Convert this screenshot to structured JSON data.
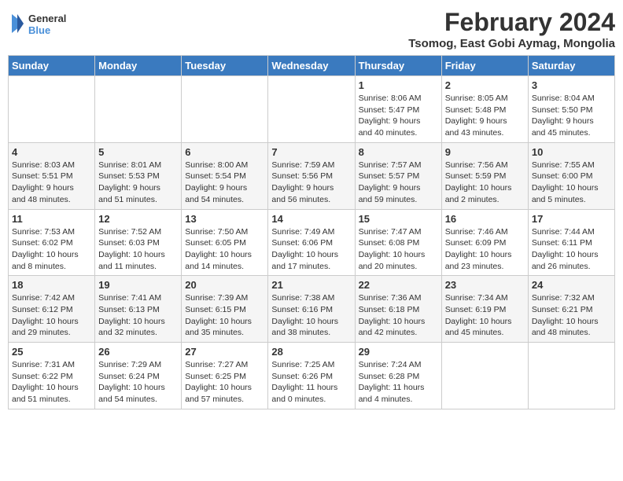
{
  "logo": {
    "line1": "General",
    "line2": "Blue"
  },
  "title": "February 2024",
  "location": "Tsomog, East Gobi Aymag, Mongolia",
  "days_of_week": [
    "Sunday",
    "Monday",
    "Tuesday",
    "Wednesday",
    "Thursday",
    "Friday",
    "Saturday"
  ],
  "weeks": [
    [
      {
        "day": "",
        "info": ""
      },
      {
        "day": "",
        "info": ""
      },
      {
        "day": "",
        "info": ""
      },
      {
        "day": "",
        "info": ""
      },
      {
        "day": "1",
        "info": "Sunrise: 8:06 AM\nSunset: 5:47 PM\nDaylight: 9 hours\nand 40 minutes."
      },
      {
        "day": "2",
        "info": "Sunrise: 8:05 AM\nSunset: 5:48 PM\nDaylight: 9 hours\nand 43 minutes."
      },
      {
        "day": "3",
        "info": "Sunrise: 8:04 AM\nSunset: 5:50 PM\nDaylight: 9 hours\nand 45 minutes."
      }
    ],
    [
      {
        "day": "4",
        "info": "Sunrise: 8:03 AM\nSunset: 5:51 PM\nDaylight: 9 hours\nand 48 minutes."
      },
      {
        "day": "5",
        "info": "Sunrise: 8:01 AM\nSunset: 5:53 PM\nDaylight: 9 hours\nand 51 minutes."
      },
      {
        "day": "6",
        "info": "Sunrise: 8:00 AM\nSunset: 5:54 PM\nDaylight: 9 hours\nand 54 minutes."
      },
      {
        "day": "7",
        "info": "Sunrise: 7:59 AM\nSunset: 5:56 PM\nDaylight: 9 hours\nand 56 minutes."
      },
      {
        "day": "8",
        "info": "Sunrise: 7:57 AM\nSunset: 5:57 PM\nDaylight: 9 hours\nand 59 minutes."
      },
      {
        "day": "9",
        "info": "Sunrise: 7:56 AM\nSunset: 5:59 PM\nDaylight: 10 hours\nand 2 minutes."
      },
      {
        "day": "10",
        "info": "Sunrise: 7:55 AM\nSunset: 6:00 PM\nDaylight: 10 hours\nand 5 minutes."
      }
    ],
    [
      {
        "day": "11",
        "info": "Sunrise: 7:53 AM\nSunset: 6:02 PM\nDaylight: 10 hours\nand 8 minutes."
      },
      {
        "day": "12",
        "info": "Sunrise: 7:52 AM\nSunset: 6:03 PM\nDaylight: 10 hours\nand 11 minutes."
      },
      {
        "day": "13",
        "info": "Sunrise: 7:50 AM\nSunset: 6:05 PM\nDaylight: 10 hours\nand 14 minutes."
      },
      {
        "day": "14",
        "info": "Sunrise: 7:49 AM\nSunset: 6:06 PM\nDaylight: 10 hours\nand 17 minutes."
      },
      {
        "day": "15",
        "info": "Sunrise: 7:47 AM\nSunset: 6:08 PM\nDaylight: 10 hours\nand 20 minutes."
      },
      {
        "day": "16",
        "info": "Sunrise: 7:46 AM\nSunset: 6:09 PM\nDaylight: 10 hours\nand 23 minutes."
      },
      {
        "day": "17",
        "info": "Sunrise: 7:44 AM\nSunset: 6:11 PM\nDaylight: 10 hours\nand 26 minutes."
      }
    ],
    [
      {
        "day": "18",
        "info": "Sunrise: 7:42 AM\nSunset: 6:12 PM\nDaylight: 10 hours\nand 29 minutes."
      },
      {
        "day": "19",
        "info": "Sunrise: 7:41 AM\nSunset: 6:13 PM\nDaylight: 10 hours\nand 32 minutes."
      },
      {
        "day": "20",
        "info": "Sunrise: 7:39 AM\nSunset: 6:15 PM\nDaylight: 10 hours\nand 35 minutes."
      },
      {
        "day": "21",
        "info": "Sunrise: 7:38 AM\nSunset: 6:16 PM\nDaylight: 10 hours\nand 38 minutes."
      },
      {
        "day": "22",
        "info": "Sunrise: 7:36 AM\nSunset: 6:18 PM\nDaylight: 10 hours\nand 42 minutes."
      },
      {
        "day": "23",
        "info": "Sunrise: 7:34 AM\nSunset: 6:19 PM\nDaylight: 10 hours\nand 45 minutes."
      },
      {
        "day": "24",
        "info": "Sunrise: 7:32 AM\nSunset: 6:21 PM\nDaylight: 10 hours\nand 48 minutes."
      }
    ],
    [
      {
        "day": "25",
        "info": "Sunrise: 7:31 AM\nSunset: 6:22 PM\nDaylight: 10 hours\nand 51 minutes."
      },
      {
        "day": "26",
        "info": "Sunrise: 7:29 AM\nSunset: 6:24 PM\nDaylight: 10 hours\nand 54 minutes."
      },
      {
        "day": "27",
        "info": "Sunrise: 7:27 AM\nSunset: 6:25 PM\nDaylight: 10 hours\nand 57 minutes."
      },
      {
        "day": "28",
        "info": "Sunrise: 7:25 AM\nSunset: 6:26 PM\nDaylight: 11 hours\nand 0 minutes."
      },
      {
        "day": "29",
        "info": "Sunrise: 7:24 AM\nSunset: 6:28 PM\nDaylight: 11 hours\nand 4 minutes."
      },
      {
        "day": "",
        "info": ""
      },
      {
        "day": "",
        "info": ""
      }
    ]
  ]
}
